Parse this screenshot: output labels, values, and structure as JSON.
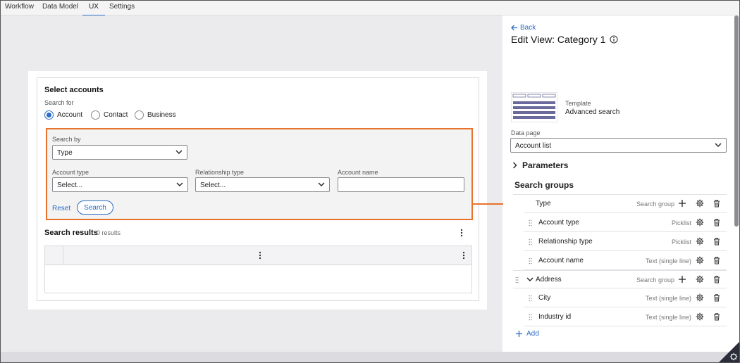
{
  "topnav": {
    "tabs": [
      "Workflow",
      "Data Model",
      "UX",
      "Settings"
    ],
    "active": "UX"
  },
  "form": {
    "title": "Select accounts",
    "search_for_label": "Search for",
    "radios": [
      {
        "label": "Account",
        "selected": true
      },
      {
        "label": "Contact",
        "selected": false
      },
      {
        "label": "Business",
        "selected": false
      }
    ],
    "search_by_label": "Search by",
    "search_by_value": "Type",
    "fields": [
      {
        "label": "Account type",
        "value": "Select..."
      },
      {
        "label": "Relationship type",
        "value": "Select..."
      },
      {
        "label": "Account name",
        "value": ""
      }
    ],
    "reset_label": "Reset",
    "search_label": "Search",
    "results_title": "Search results",
    "results_count": "0 results"
  },
  "panel": {
    "back_label": "Back",
    "title": "Edit View: Category 1",
    "template_label": "Template",
    "template_value": "Advanced search",
    "data_page_label": "Data page",
    "data_page_value": "Account list",
    "parameters_label": "Parameters",
    "search_groups_label": "Search groups",
    "groups": [
      {
        "name": "Type",
        "type": "Search group",
        "fields": [
          {
            "name": "Account type",
            "type": "Picklist"
          },
          {
            "name": "Relationship type",
            "type": "Picklist"
          },
          {
            "name": "Account name",
            "type": "Text (single line)"
          }
        ]
      },
      {
        "name": "Address",
        "type": "Search group",
        "fields": [
          {
            "name": "City",
            "type": "Text (single line)"
          },
          {
            "name": "Industry id",
            "type": "Text (single line)"
          }
        ]
      }
    ],
    "add_label": "Add"
  },
  "colors": {
    "accent": "#2b6cc4",
    "highlight": "#e8722c"
  }
}
